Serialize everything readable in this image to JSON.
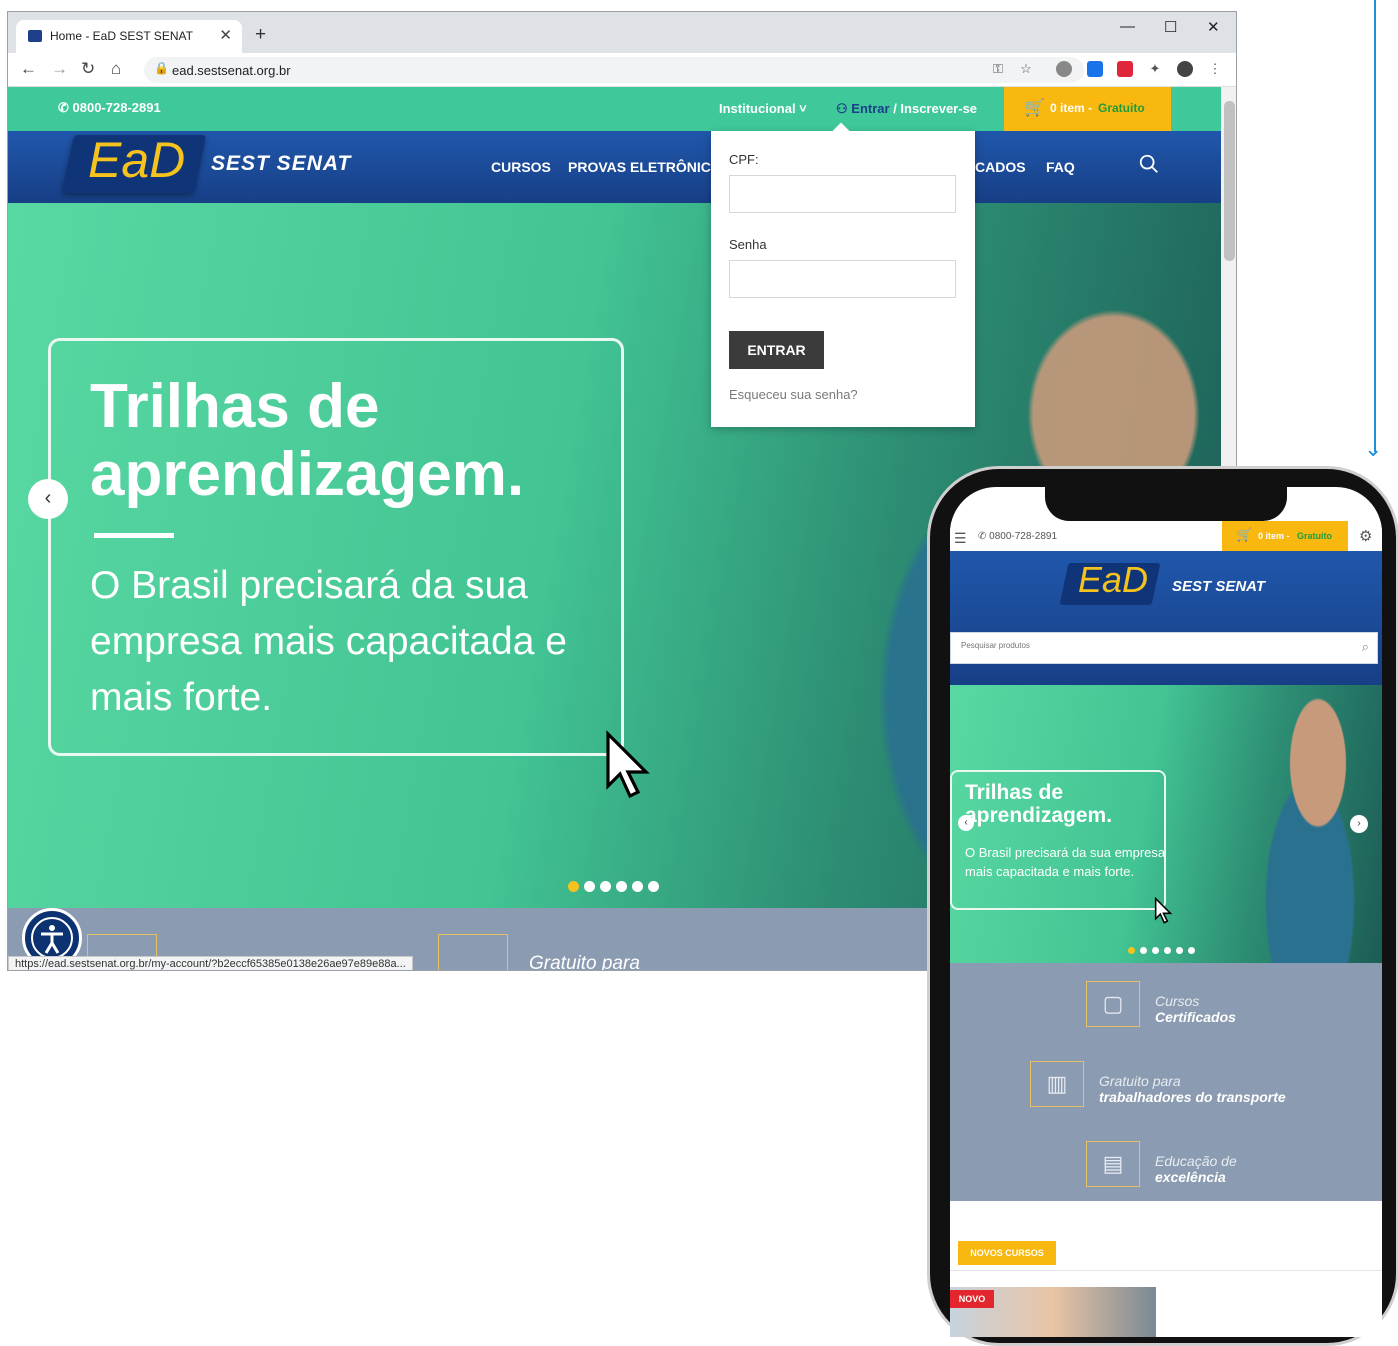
{
  "browser": {
    "tab_title": "Home - EaD SEST SENAT",
    "url": "ead.sestsenat.org.br",
    "status_url": "https://ead.sestsenat.org.br/my-account/?b2eccf65385e0138e26ae97e89e88a..."
  },
  "site": {
    "phone": "0800-728-2891",
    "institucional": "Institucional",
    "entrar": "Entrar",
    "inscrever": " / Inscrever-se",
    "cart_count": "0 item",
    "cart_sep": " - ",
    "cart_free": "Gratuito",
    "logo_ead": "EaD",
    "logo_sest": "SEST SENAT",
    "nav": [
      "CURSOS",
      "PROVAS ELETRÔNICAS",
      "CADOS",
      "FAQ"
    ]
  },
  "hero": {
    "title": "Trilhas de aprendizagem.",
    "subtitle": "O Brasil precisará da sua empresa mais capacitada e mais forte.",
    "feature_partial": "Gratuito para"
  },
  "login": {
    "cpf_label": "CPF:",
    "senha_label": "Senha",
    "submit": "ENTRAR",
    "forgot": "Esqueceu sua senha?"
  },
  "mobile": {
    "phone": "0800-728-2891",
    "cart_count": "0 item",
    "cart_sep": " - ",
    "cart_free": "Gratuito",
    "logo_ead": "EaD",
    "logo_sest": "SEST SENAT",
    "search_placeholder": "Pesquisar produtos",
    "hero_title": "Trilhas de aprendizagem.",
    "hero_sub": "O Brasil precisará da sua empresa mais capacitada e mais forte.",
    "features": [
      {
        "line1": "Cursos",
        "line2": "Certificados"
      },
      {
        "line1": "Gratuito para",
        "line2": "trabalhadores do transporte"
      },
      {
        "line1": "Educação de",
        "line2": "excelência"
      }
    ],
    "novos_cursos": "NOVOS CURSOS",
    "novo_tag": "NOVO"
  },
  "colors": {
    "brand_blue": "#1b4c9c",
    "brand_yellow": "#f8b80f",
    "hero_green": "#42c493",
    "arrow_blue": "#1e8fd8"
  }
}
